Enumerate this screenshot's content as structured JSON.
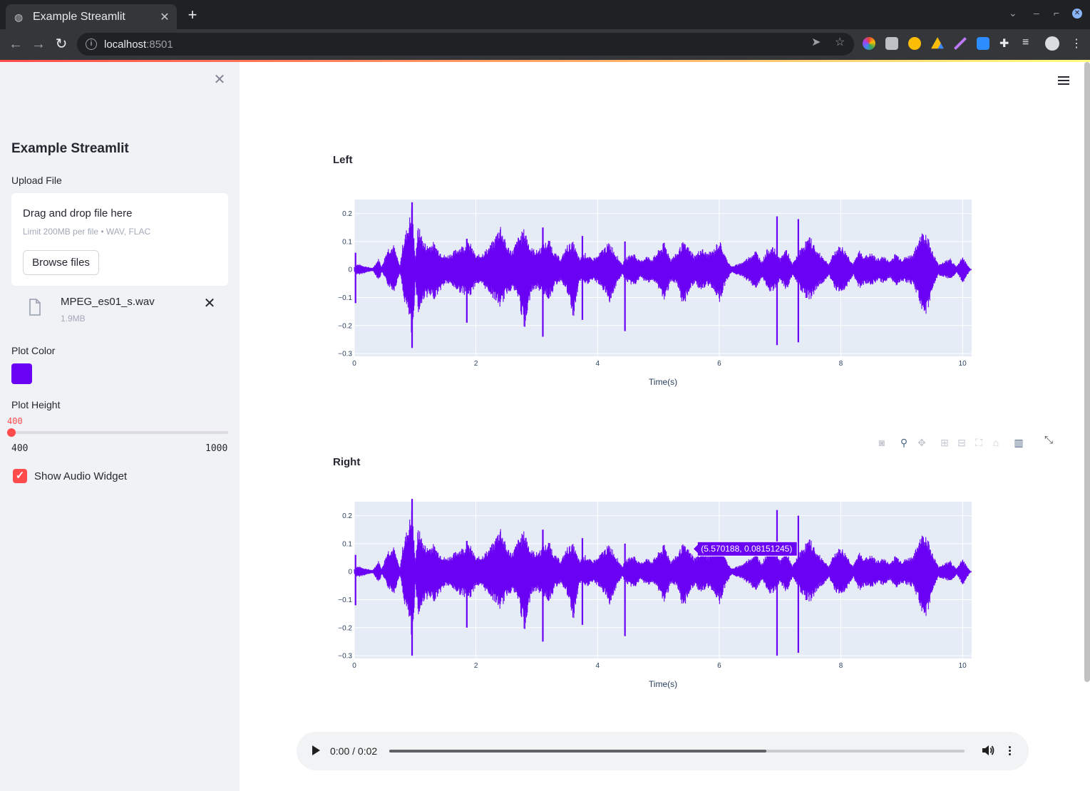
{
  "browser": {
    "tab_title": "Example Streamlit",
    "tab_close": "✕",
    "new_tab": "+",
    "url_host": "localhost",
    "url_port": ":8501"
  },
  "sidebar": {
    "close": "✕",
    "title": "Example Streamlit",
    "upload_label": "Upload File",
    "dropzone_text": "Drag and drop file here",
    "dropzone_limit": "Limit 200MB per file • WAV, FLAC",
    "browse_button": "Browse files",
    "file_name": "MPEG_es01_s.wav",
    "file_size": "1.9MB",
    "file_delete": "✕",
    "plot_color_label": "Plot Color",
    "plot_color_value": "#6a00f4",
    "plot_height_label": "Plot Height",
    "plot_height_value": "400",
    "plot_height_min": "400",
    "plot_height_max": "1000",
    "plot_height_fraction": 0,
    "show_audio_label": "Show Audio Widget",
    "show_audio_checked": true,
    "check_mark": "✓"
  },
  "main": {
    "left_title": "Left",
    "right_title": "Right",
    "hover_tooltip": "(5.570188, 0.08151245)",
    "modebar": [
      "camera-icon",
      "zoom-icon",
      "pan-icon",
      "zoom-in-icon",
      "zoom-out-icon",
      "autoscale-icon",
      "reset-axes-icon",
      "plotly-logo-icon"
    ]
  },
  "audio": {
    "time": "0:00 / 0:02",
    "progress": 0.655
  },
  "chart_data": [
    {
      "type": "line",
      "title": "Left",
      "xlabel": "Time(s)",
      "ylabel": "",
      "xlim": [
        0,
        10.15
      ],
      "ylim": [
        -0.31,
        0.25
      ],
      "xticks": [
        0,
        2,
        4,
        6,
        8,
        10
      ],
      "yticks": [
        0.2,
        0.1,
        0,
        -0.1,
        -0.2,
        -0.3
      ],
      "ytick_labels": [
        "0.2",
        "0.1",
        "0",
        "−0.1",
        "−0.2",
        "−0.3"
      ],
      "grid": true,
      "color": "#6a00f4",
      "envelope": {
        "x": [
          0,
          0.05,
          0.3,
          0.4,
          0.45,
          0.55,
          0.65,
          0.75,
          0.8,
          0.9,
          0.95,
          1.0,
          1.05,
          1.15,
          1.2,
          1.3,
          1.4,
          1.5,
          1.6,
          1.7,
          1.8,
          1.9,
          2.0,
          2.1,
          2.2,
          2.3,
          2.4,
          2.5,
          2.6,
          2.7,
          2.8,
          2.9,
          3.0,
          3.1,
          3.2,
          3.3,
          3.4,
          3.5,
          3.6,
          3.7,
          3.8,
          3.9,
          4.0,
          4.1,
          4.2,
          4.3,
          4.4,
          4.5,
          4.6,
          4.7,
          4.8,
          4.9,
          5.0,
          5.1,
          5.2,
          5.3,
          5.4,
          5.5,
          5.6,
          5.7,
          5.8,
          5.9,
          6.0,
          6.1,
          6.2,
          6.3,
          6.4,
          6.5,
          6.6,
          6.7,
          6.8,
          6.9,
          7.0,
          7.1,
          7.2,
          7.3,
          7.4,
          7.5,
          7.6,
          7.7,
          7.8,
          7.9,
          8.0,
          8.1,
          8.2,
          8.3,
          8.4,
          8.5,
          8.6,
          8.7,
          8.8,
          8.9,
          9.0,
          9.1,
          9.2,
          9.3,
          9.4,
          9.5,
          9.6,
          9.7,
          9.8,
          9.9,
          10.0,
          10.1,
          10.15
        ],
        "max": [
          0.01,
          0.02,
          0.005,
          0.04,
          0.01,
          0.08,
          0.09,
          0.01,
          0.1,
          0.18,
          0.24,
          0.04,
          0.16,
          0.1,
          0.09,
          0.1,
          0.07,
          0.05,
          0.06,
          0.08,
          0.09,
          0.1,
          0.05,
          0.06,
          0.08,
          0.11,
          0.17,
          0.09,
          0.07,
          0.12,
          0.15,
          0.08,
          0.07,
          0.09,
          0.11,
          0.06,
          0.04,
          0.09,
          0.1,
          0.04,
          0.06,
          0.04,
          0.05,
          0.08,
          0.1,
          0.06,
          0.02,
          0.05,
          0.06,
          0.03,
          0.05,
          0.04,
          0.07,
          0.1,
          0.04,
          0.06,
          0.1,
          0.08,
          0.05,
          0.08,
          0.06,
          0.07,
          0.11,
          0.05,
          0.01,
          0.02,
          0.03,
          0.05,
          0.07,
          0.03,
          0.08,
          0.08,
          0.04,
          0.08,
          0.02,
          0.06,
          0.1,
          0.12,
          0.07,
          0.05,
          0.02,
          0.07,
          0.09,
          0.06,
          0.02,
          0.07,
          0.05,
          0.06,
          0.04,
          0.05,
          0.03,
          0.06,
          0.04,
          0.05,
          0.06,
          0.13,
          0.14,
          0.07,
          0.02,
          0.03,
          0.04,
          0.01,
          0.05,
          0.01,
          0.0
        ],
        "min": [
          -0.01,
          -0.02,
          -0.005,
          -0.04,
          -0.01,
          -0.06,
          -0.08,
          -0.01,
          -0.1,
          -0.18,
          -0.28,
          -0.04,
          -0.17,
          -0.1,
          -0.1,
          -0.11,
          -0.08,
          -0.05,
          -0.06,
          -0.08,
          -0.09,
          -0.1,
          -0.05,
          -0.06,
          -0.08,
          -0.11,
          -0.14,
          -0.09,
          -0.07,
          -0.11,
          -0.24,
          -0.08,
          -0.07,
          -0.09,
          -0.11,
          -0.06,
          -0.04,
          -0.09,
          -0.18,
          -0.04,
          -0.06,
          -0.04,
          -0.05,
          -0.08,
          -0.12,
          -0.06,
          -0.02,
          -0.05,
          -0.06,
          -0.03,
          -0.05,
          -0.04,
          -0.07,
          -0.12,
          -0.04,
          -0.06,
          -0.14,
          -0.08,
          -0.05,
          -0.08,
          -0.06,
          -0.07,
          -0.12,
          -0.05,
          -0.01,
          -0.02,
          -0.03,
          -0.05,
          -0.07,
          -0.03,
          -0.08,
          -0.08,
          -0.04,
          -0.08,
          -0.02,
          -0.06,
          -0.1,
          -0.11,
          -0.07,
          -0.05,
          -0.02,
          -0.07,
          -0.09,
          -0.06,
          -0.02,
          -0.07,
          -0.05,
          -0.06,
          -0.04,
          -0.05,
          -0.03,
          -0.06,
          -0.04,
          -0.05,
          -0.06,
          -0.13,
          -0.18,
          -0.07,
          -0.02,
          -0.03,
          -0.04,
          -0.01,
          -0.05,
          -0.01,
          0.0
        ]
      },
      "spikes": [
        {
          "x": 0.02,
          "min": -0.12,
          "max": 0.06
        },
        {
          "x": 0.95,
          "min": -0.28,
          "max": 0.24
        },
        {
          "x": 1.85,
          "min": -0.19,
          "max": 0.11
        },
        {
          "x": 3.1,
          "min": -0.24,
          "max": 0.15
        },
        {
          "x": 3.75,
          "min": -0.18,
          "max": 0.12
        },
        {
          "x": 4.45,
          "min": -0.22,
          "max": 0.1
        },
        {
          "x": 6.95,
          "min": -0.27,
          "max": 0.19
        },
        {
          "x": 7.3,
          "min": -0.26,
          "max": 0.18
        }
      ]
    },
    {
      "type": "line",
      "title": "Right",
      "xlabel": "Time(s)",
      "ylabel": "",
      "xlim": [
        0,
        10.15
      ],
      "ylim": [
        -0.31,
        0.25
      ],
      "xticks": [
        0,
        2,
        4,
        6,
        8,
        10
      ],
      "yticks": [
        0.2,
        0.1,
        0,
        -0.1,
        -0.2,
        -0.3
      ],
      "ytick_labels": [
        "0.2",
        "0.1",
        "0",
        "−0.1",
        "−0.2",
        "−0.3"
      ],
      "grid": true,
      "color": "#6a00f4",
      "tooltip": {
        "x": 5.570188,
        "y": 0.08151245
      },
      "envelope": "same-as-left",
      "spikes": [
        {
          "x": 0.02,
          "min": -0.12,
          "max": 0.06
        },
        {
          "x": 0.95,
          "min": -0.3,
          "max": 0.26
        },
        {
          "x": 1.85,
          "min": -0.2,
          "max": 0.11
        },
        {
          "x": 3.1,
          "min": -0.25,
          "max": 0.15
        },
        {
          "x": 3.75,
          "min": -0.19,
          "max": 0.12
        },
        {
          "x": 4.45,
          "min": -0.23,
          "max": 0.1
        },
        {
          "x": 6.95,
          "min": -0.3,
          "max": 0.22
        },
        {
          "x": 7.3,
          "min": -0.29,
          "max": 0.2
        }
      ]
    }
  ]
}
